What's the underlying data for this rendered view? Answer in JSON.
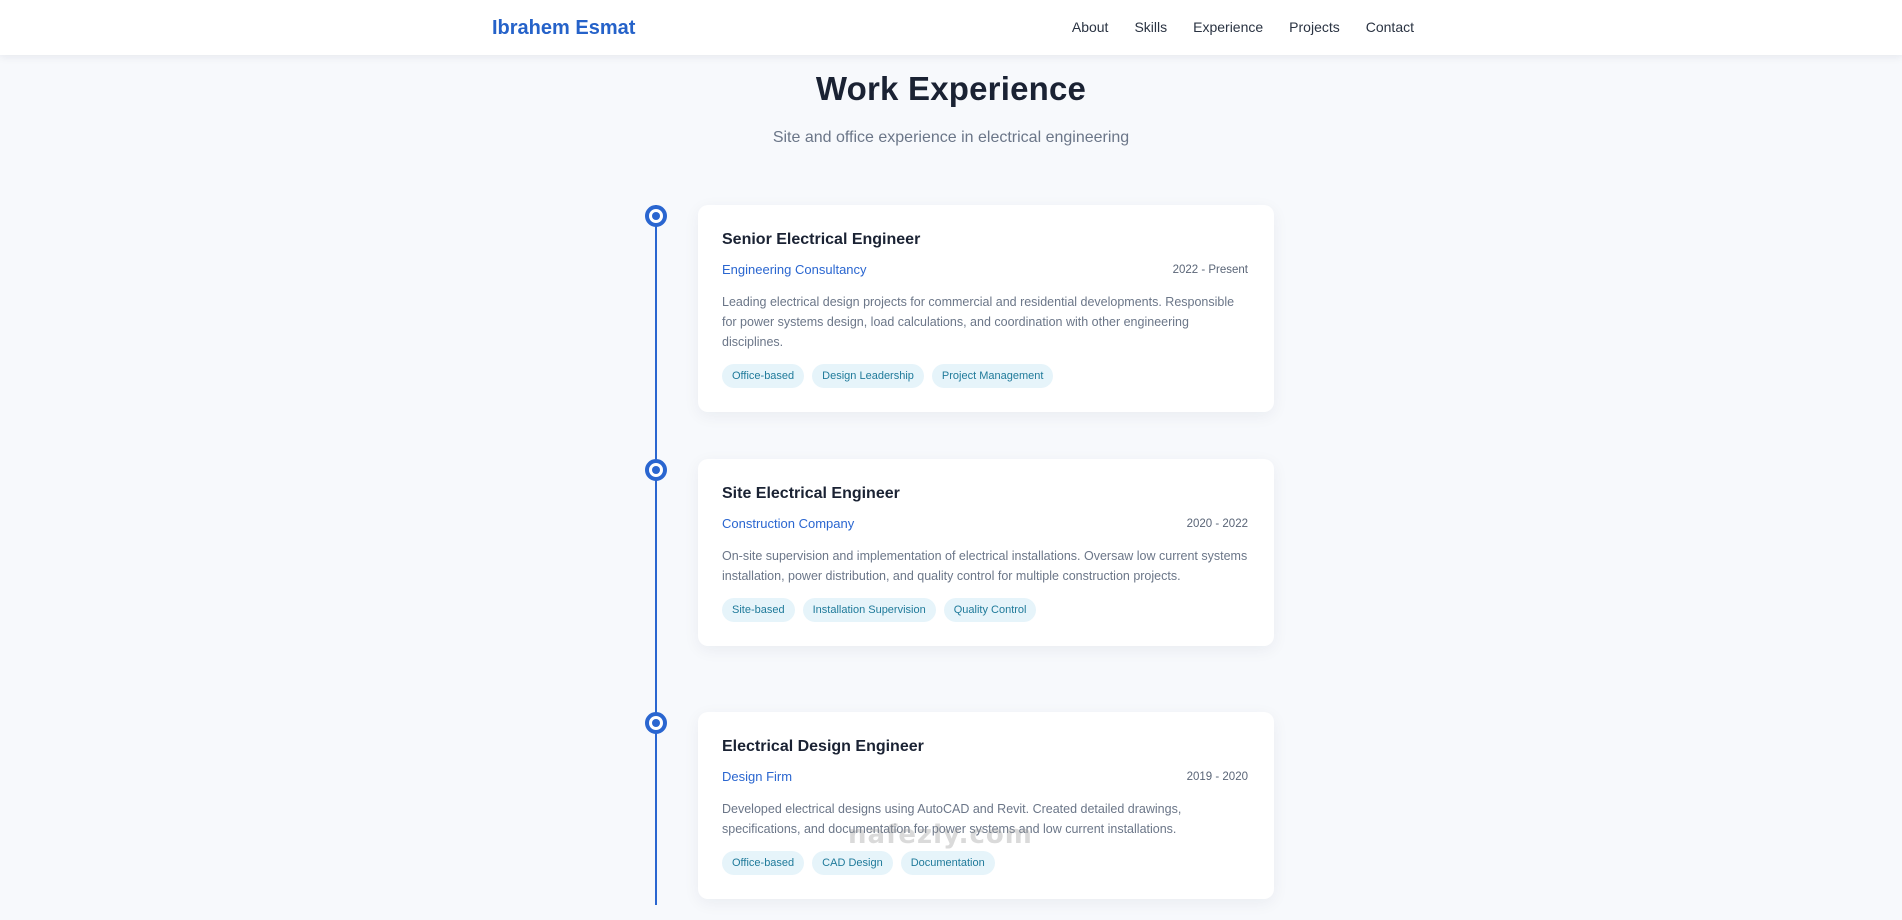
{
  "nav": {
    "brand": "Ibrahem Esmat",
    "links": [
      {
        "label": "About"
      },
      {
        "label": "Skills"
      },
      {
        "label": "Experience"
      },
      {
        "label": "Projects"
      },
      {
        "label": "Contact"
      }
    ]
  },
  "section": {
    "title": "Work Experience",
    "subtitle": "Site and office experience in electrical engineering"
  },
  "experience": [
    {
      "title": "Senior Electrical Engineer",
      "company": "Engineering Consultancy",
      "date": "2022 - Present",
      "description": "Leading electrical design projects for commercial and residential developments. Responsible for power systems design, load calculations, and coordination with other engineering disciplines.",
      "tags": [
        "Office-based",
        "Design Leadership",
        "Project Management"
      ]
    },
    {
      "title": "Site Electrical Engineer",
      "company": "Construction Company",
      "date": "2020 - 2022",
      "description": "On-site supervision and implementation of electrical installations. Oversaw low current systems installation, power distribution, and quality control for multiple construction projects.",
      "tags": [
        "Site-based",
        "Installation Supervision",
        "Quality Control"
      ]
    },
    {
      "title": "Electrical Design Engineer",
      "company": "Design Firm",
      "date": "2019 - 2020",
      "description": "Developed electrical designs using AutoCAD and Revit. Created detailed drawings, specifications, and documentation for power systems and low current installations.",
      "tags": [
        "Office-based",
        "CAD Design",
        "Documentation"
      ]
    }
  ],
  "watermark": {
    "text": "nafezly.com"
  },
  "colors": {
    "accent": "#2a66d0",
    "tag_bg": "#e6f4fa",
    "tag_text": "#1f7a9a"
  }
}
